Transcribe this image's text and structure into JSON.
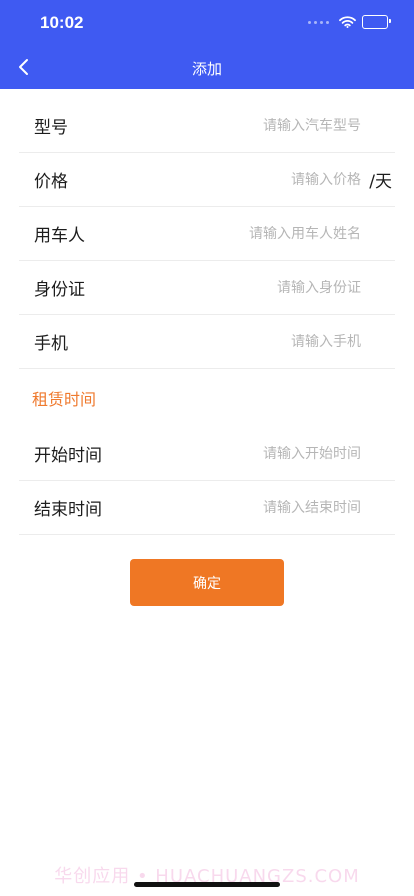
{
  "status_bar": {
    "time": "10:02"
  },
  "nav": {
    "title": "添加"
  },
  "form": {
    "model": {
      "label": "型号",
      "placeholder": "请输入汽车型号"
    },
    "price": {
      "label": "价格",
      "placeholder": "请输入价格",
      "unit": "/天"
    },
    "renter": {
      "label": "用车人",
      "placeholder": "请输入用车人姓名"
    },
    "id_card": {
      "label": "身份证",
      "placeholder": "请输入身份证"
    },
    "phone": {
      "label": "手机",
      "placeholder": "请输入手机"
    }
  },
  "rental_section": {
    "title": "租赁时间",
    "start": {
      "label": "开始时间",
      "placeholder": "请输入开始时间"
    },
    "end": {
      "label": "结束时间",
      "placeholder": "请输入结束时间"
    }
  },
  "confirm_label": "确定",
  "watermark": "华创应用 • HUACHUANGZS.COM",
  "colors": {
    "header": "#3f5af2",
    "accent": "#ef7724"
  }
}
